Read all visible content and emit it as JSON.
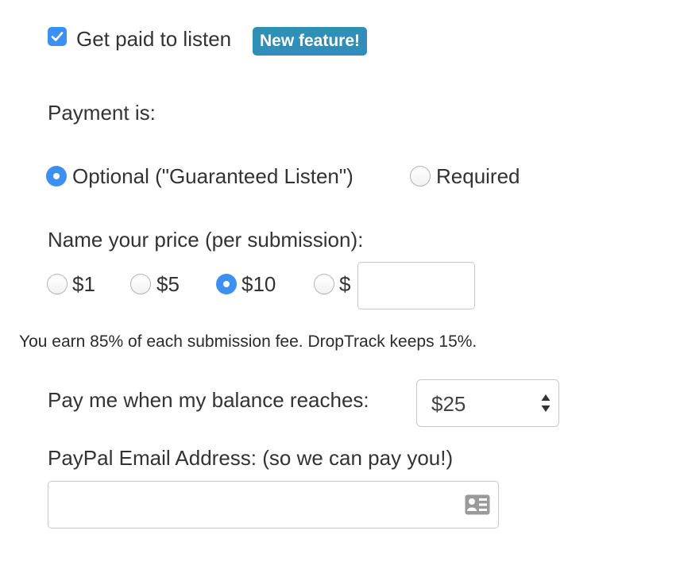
{
  "listen": {
    "checkbox_checked": true,
    "label": "Get paid to listen",
    "badge": "New feature!",
    "badge_color": "#2f8fb7",
    "accent_color": "#3d8ff0"
  },
  "payment": {
    "label": "Payment is:",
    "options": [
      {
        "label": "Optional (\"Guaranteed Listen\")",
        "checked": true
      },
      {
        "label": "Required",
        "checked": false
      }
    ]
  },
  "price": {
    "label": "Name your price (per submission):",
    "options": [
      {
        "label": "$1",
        "checked": false
      },
      {
        "label": "$5",
        "checked": false
      },
      {
        "label": "$10",
        "checked": true
      },
      {
        "label": "$",
        "checked": false
      }
    ],
    "custom_value": "",
    "note": "You earn 85% of each submission fee. DropTrack keeps 15%."
  },
  "payout": {
    "label": "Pay me when my balance reaches:",
    "selected": "$25",
    "arrows_icon": "up-down-arrows-icon"
  },
  "paypal": {
    "label": "PayPal Email Address: (so we can pay you!)",
    "value": "",
    "icon": "contact-card-icon"
  }
}
